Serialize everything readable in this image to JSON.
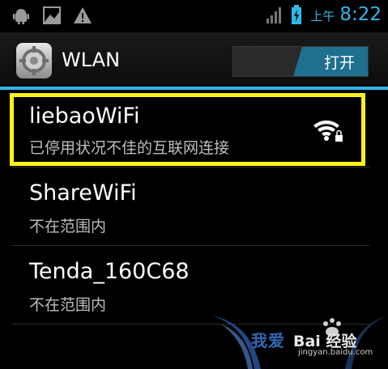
{
  "statusbar": {
    "ampm": "上午",
    "time": "8:22",
    "icons": [
      "android-debug-icon",
      "notification-image-icon",
      "warning-icon",
      "signal-icon",
      "battery-charging-icon"
    ]
  },
  "actionbar": {
    "title": "WLAN",
    "toggle_label": "打开"
  },
  "networks": [
    {
      "name": "liebaoWiFi",
      "status": "已停用状况不佳的互联网连接",
      "highlighted": true,
      "icon": "wifi-locked-icon"
    },
    {
      "name": "ShareWiFi",
      "status": "不在范围内"
    },
    {
      "name": "Tenda_160C68",
      "status": "不在范围内"
    }
  ],
  "watermark": {
    "text": "我爱",
    "brand": "Bai 经验",
    "url": "jingyan.baidu.com"
  },
  "colors": {
    "accent": "#33b5e5",
    "highlight": "#fff21a"
  }
}
